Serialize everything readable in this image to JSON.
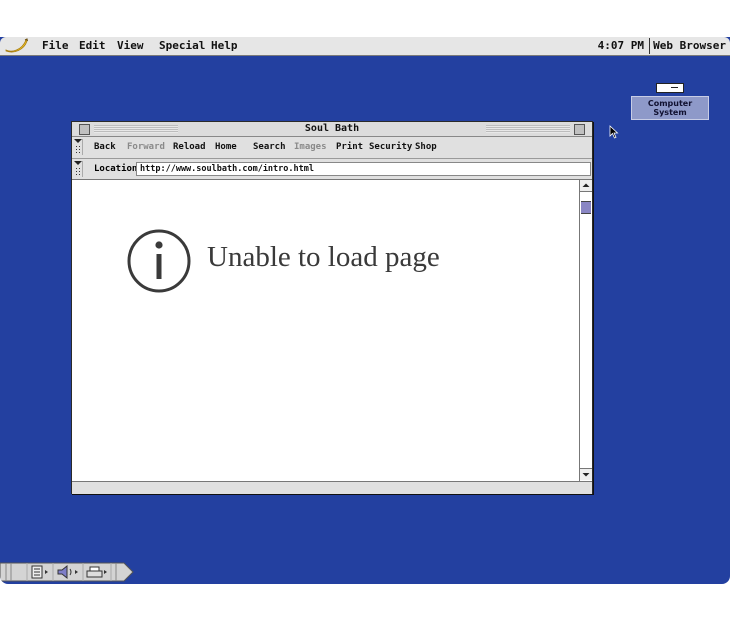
{
  "menubar": {
    "items": [
      "File",
      "Edit",
      "View",
      "Special",
      "Help"
    ],
    "clock": "4:07 PM",
    "app_name": "Web Browser"
  },
  "desktop": {
    "icon_label": "Computer System",
    "icon": "computer-system-icon"
  },
  "window": {
    "title": "Soul Bath",
    "toolbar": {
      "back": "Back",
      "forward": "Forward",
      "reload": "Reload",
      "home": "Home",
      "search": "Search",
      "images": "Images",
      "print": "Print",
      "security": "Security",
      "shop": "Shop"
    },
    "location_label": "Location",
    "url": "http://www.soulbath.com/intro.html",
    "error_message": "Unable to load page",
    "error_icon": "info-icon"
  },
  "control_strip": {
    "icons": [
      "document-icon",
      "speaker-icon",
      "printer-icon"
    ]
  },
  "colors": {
    "desktop": "#2340a0",
    "scroll_thumb": "#8a86c4",
    "icon_label_bg": "#8e99c9"
  }
}
